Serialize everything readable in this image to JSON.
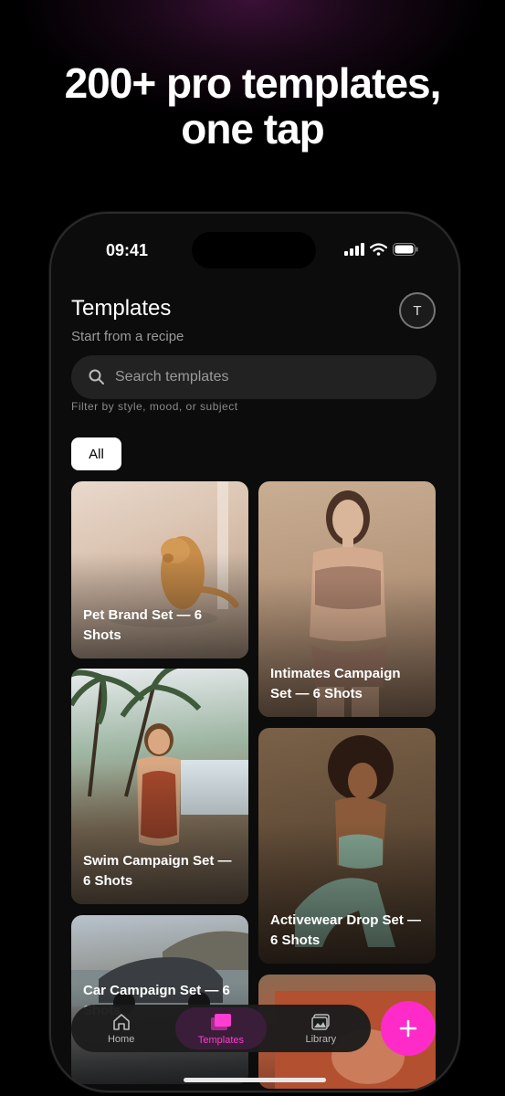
{
  "headline": {
    "line1": "200+ pro templates,",
    "line2": "one tap"
  },
  "status_bar": {
    "time": "09:41"
  },
  "header": {
    "title": "Templates",
    "subtitle": "Start from a recipe",
    "avatar_initial": "T"
  },
  "search": {
    "placeholder": "Search templates",
    "hint": "Filter by style, mood, or subject"
  },
  "filters": {
    "selected": "All"
  },
  "templates": [
    {
      "label": "Pet Brand Set — 6 Shots"
    },
    {
      "label": "Intimates Campaign Set — 6 Shots"
    },
    {
      "label": "Swim Campaign Set — 6 Shots"
    },
    {
      "label": "Activewear Drop Set — 6 Shots"
    },
    {
      "label": "Car Campaign Set — 6 Shots"
    },
    {
      "label": ""
    }
  ],
  "tab_bar": {
    "tabs": [
      {
        "label": "Home",
        "icon": "house-icon"
      },
      {
        "label": "Templates",
        "icon": "templates-stack-icon",
        "active": true
      },
      {
        "label": "Library",
        "icon": "image-library-icon"
      }
    ],
    "fab_icon": "plus-icon"
  },
  "colors": {
    "accent": "#ff2bc8",
    "active_tab_bg": "#3a1d39",
    "background": "#000000"
  }
}
